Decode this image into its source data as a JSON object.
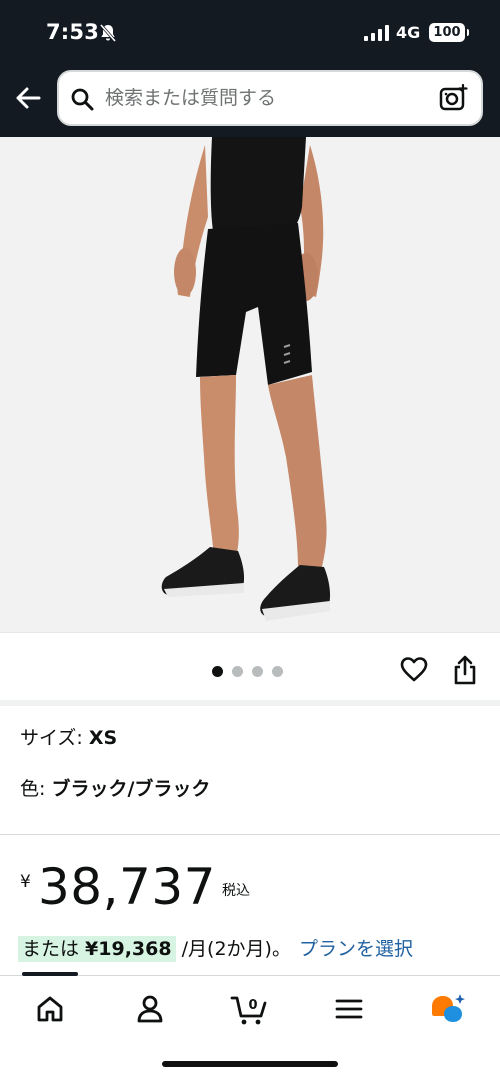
{
  "status": {
    "time": "7:53",
    "network": "4G",
    "battery": "100"
  },
  "search": {
    "placeholder": "検索または質問する"
  },
  "gallery": {
    "image_count": 4,
    "active_index": 0
  },
  "product": {
    "size_label": "サイズ: ",
    "size_value": "XS",
    "color_label": "色: ",
    "color_value": "ブラック/ブラック",
    "currency": "¥",
    "price": "38,737",
    "tax_note": "税込",
    "installment_prefix": "または ",
    "installment_amount": "¥19,368",
    "installment_suffix": " /月(2か月)。",
    "plan_link": "プランを選択"
  },
  "bottom_nav": {
    "cart_count": "0"
  },
  "colors": {
    "header_bg": "#131a22",
    "link": "#2162a1",
    "install_highlight": "#d7f4e3"
  }
}
